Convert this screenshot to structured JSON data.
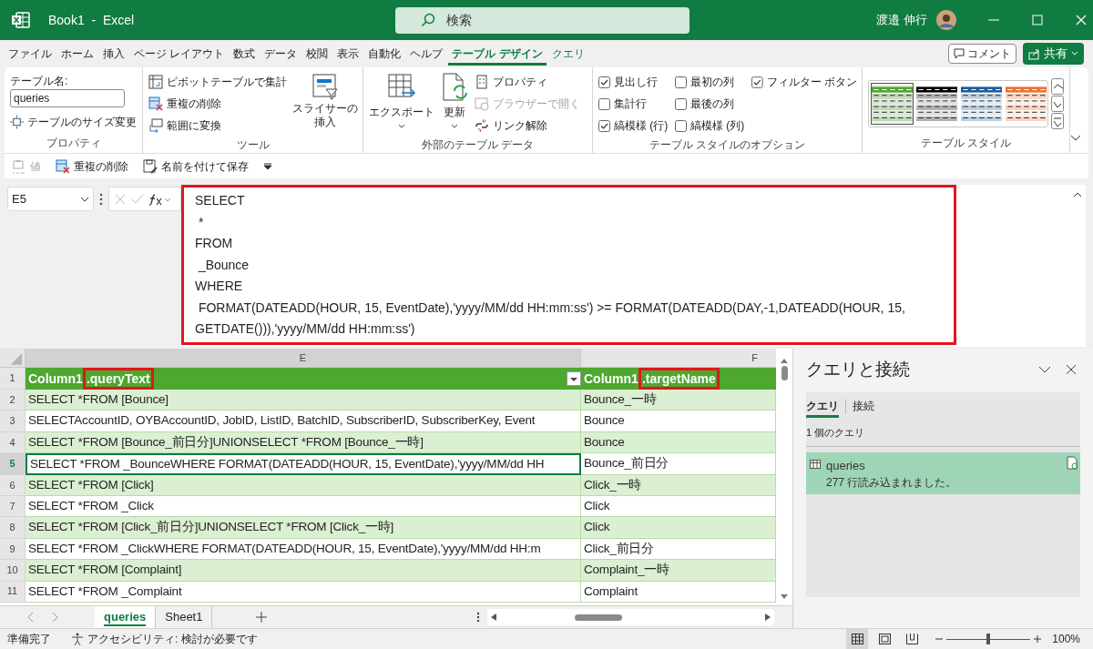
{
  "window": {
    "title": "Book1  -  Excel",
    "search_placeholder": "検索",
    "user_name": "渡邉 伸行"
  },
  "menu_tabs": [
    {
      "label": "ファイル",
      "selected": false,
      "contextual": false
    },
    {
      "label": "ホーム",
      "selected": false,
      "contextual": false
    },
    {
      "label": "挿入",
      "selected": false,
      "contextual": false
    },
    {
      "label": "ページ レイアウト",
      "selected": false,
      "contextual": false
    },
    {
      "label": "数式",
      "selected": false,
      "contextual": false
    },
    {
      "label": "データ",
      "selected": false,
      "contextual": false
    },
    {
      "label": "校閲",
      "selected": false,
      "contextual": false
    },
    {
      "label": "表示",
      "selected": false,
      "contextual": false
    },
    {
      "label": "自動化",
      "selected": false,
      "contextual": false
    },
    {
      "label": "ヘルプ",
      "selected": false,
      "contextual": false
    },
    {
      "label": "テーブル デザイン",
      "selected": true,
      "contextual": true
    },
    {
      "label": "クエリ",
      "selected": false,
      "contextual": true
    }
  ],
  "comment_button": "コメント",
  "share_button": "共有",
  "ribbon": {
    "properties": {
      "name_label": "テーブル名:",
      "table_name": "queries",
      "resize_button": "テーブルのサイズ変更",
      "group_label": "プロパティ"
    },
    "tools": {
      "items": [
        {
          "label": "ピボットテーブルで集計",
          "kind": "pivot"
        },
        {
          "label": "重複の削除",
          "kind": "dedupe"
        },
        {
          "label": "範囲に変換",
          "kind": "convert"
        }
      ],
      "slicer_button": [
        "スライサーの",
        "挿入"
      ],
      "group_label": "ツール"
    },
    "external_data": {
      "export_button": "エクスポート",
      "refresh_button": "更新",
      "items": [
        {
          "label": "プロパティ",
          "disabled": false,
          "kind": "properties"
        },
        {
          "label": "ブラウザーで開く",
          "disabled": true,
          "kind": "browser"
        },
        {
          "label": "リンク解除",
          "disabled": false,
          "kind": "unlink"
        }
      ],
      "group_label": "外部のテーブル データ"
    },
    "style_options": {
      "checkboxes": [
        {
          "label": "見出し行",
          "checked": true,
          "kind": "header_row"
        },
        {
          "label": "集計行",
          "checked": false,
          "kind": "total_row"
        },
        {
          "label": "縞模様 (行)",
          "checked": true,
          "kind": "banded_rows"
        },
        {
          "label": "最初の列",
          "checked": false,
          "kind": "first_column"
        },
        {
          "label": "最後の列",
          "checked": false,
          "kind": "last_column"
        },
        {
          "label": "縞模様 (列)",
          "checked": false,
          "kind": "banded_columns"
        },
        {
          "label": "フィルター ボタン",
          "checked": true,
          "kind": "filter_button"
        }
      ],
      "group_label": "テーブル スタイルのオプション"
    },
    "table_styles": {
      "swatches": [
        {
          "color": "#4ea72e",
          "selected": true
        },
        {
          "color": "#000000",
          "selected": false
        },
        {
          "color": "#1f5c99",
          "selected": false
        },
        {
          "color": "#e97132",
          "selected": false
        }
      ],
      "group_label": "テーブル スタイル"
    }
  },
  "quick_access": [
    {
      "label": "値",
      "disabled": true,
      "kind": "values"
    },
    {
      "label": "重複の削除",
      "disabled": false,
      "kind": "dedupe"
    },
    {
      "label": "名前を付けて保存",
      "disabled": false,
      "kind": "save_as"
    }
  ],
  "formula_bar": {
    "cell": "E5",
    "highlighted": true,
    "lines": [
      "SELECT",
      " *",
      "FROM",
      " _Bounce",
      "WHERE",
      " FORMAT(DATEADD(HOUR, 15, EventDate),'yyyy/MM/dd HH:mm:ss') >= FORMAT(DATEADD(DAY,-1,DATEADD(HOUR, 15,",
      "GETDATE())),'yyyy/MM/dd HH:mm:ss')"
    ]
  },
  "sheet": {
    "column_headers": [
      "E",
      "F"
    ],
    "header_row_number": "1",
    "table_header": [
      {
        "prefix": "Column1",
        "field": ".queryText",
        "highlighted": true
      },
      {
        "prefix": "Column1",
        "field": ".targetName",
        "highlighted": true
      }
    ],
    "rows": [
      {
        "number": "2",
        "cells": [
          "SELECT *FROM [Bounce]",
          "Bounce_一時"
        ],
        "active": false
      },
      {
        "number": "3",
        "cells": [
          "SELECTAccountID, OYBAccountID, JobID, ListID, BatchID, SubscriberID, SubscriberKey, Event",
          "Bounce"
        ],
        "active": false
      },
      {
        "number": "4",
        "cells": [
          "SELECT *FROM [Bounce_前日分]UNIONSELECT *FROM [Bounce_一時]",
          "Bounce"
        ],
        "active": false
      },
      {
        "number": "5",
        "cells": [
          "SELECT *FROM _BounceWHERE FORMAT(DATEADD(HOUR, 15, EventDate),'yyyy/MM/dd HH",
          "Bounce_前日分"
        ],
        "active": true
      },
      {
        "number": "6",
        "cells": [
          "SELECT *FROM [Click]",
          "Click_一時"
        ],
        "active": false
      },
      {
        "number": "7",
        "cells": [
          "SELECT *FROM _Click",
          "Click"
        ],
        "active": false
      },
      {
        "number": "8",
        "cells": [
          "SELECT *FROM [Click_前日分]UNIONSELECT *FROM [Click_一時]",
          "Click"
        ],
        "active": false
      },
      {
        "number": "9",
        "cells": [
          "SELECT *FROM _ClickWHERE FORMAT(DATEADD(HOUR, 15, EventDate),'yyyy/MM/dd HH:m",
          "Click_前日分"
        ],
        "active": false
      },
      {
        "number": "10",
        "cells": [
          "SELECT *FROM [Complaint]",
          "Complaint_一時"
        ],
        "active": false
      },
      {
        "number": "11",
        "cells": [
          "SELECT *FROM _Complaint",
          "Complaint"
        ],
        "active": false
      }
    ]
  },
  "pane": {
    "title": "クエリと接続",
    "tabs": [
      {
        "label": "クエリ",
        "selected": true
      },
      {
        "label": "接続",
        "selected": false
      }
    ],
    "count": "1 個のクエリ",
    "queries": [
      {
        "name": "queries",
        "status": "277 行読み込まれました。",
        "selected": true
      }
    ]
  },
  "sheet_tabs": [
    {
      "label": "queries",
      "selected": true
    },
    {
      "label": "Sheet1",
      "selected": false
    }
  ],
  "status_bar": {
    "ready": "準備完了",
    "accessibility": "アクセシビリティ: 検討が必要です",
    "views": [
      {
        "kind": "normal",
        "selected": true
      },
      {
        "kind": "page_layout",
        "selected": false
      },
      {
        "kind": "page_break",
        "selected": false
      }
    ],
    "zoom": {
      "level": 0.5,
      "label": "100%"
    }
  }
}
